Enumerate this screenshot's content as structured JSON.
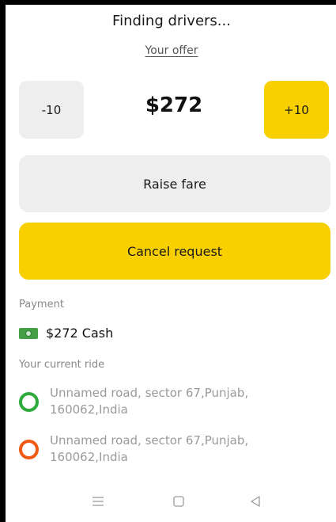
{
  "header": {
    "title": "Finding drivers..."
  },
  "offer": {
    "link_label": "Your offer",
    "decrement_label": "-10",
    "price": "$272",
    "increment_label": "+10"
  },
  "actions": {
    "raise_label": "Raise fare",
    "cancel_label": "Cancel request"
  },
  "payment": {
    "section_label": "Payment",
    "method_icon": "cash-icon",
    "method_text": "$272 Cash"
  },
  "ride": {
    "section_label": "Your current ride",
    "stops": [
      {
        "address": "Unnamed road, sector 67,Punjab, 160062,India",
        "marker_color": "#2eaa3d"
      },
      {
        "address": "Unnamed road, sector 67,Punjab, 160062,India",
        "marker_color": "#f05a12"
      }
    ]
  },
  "navbar": {
    "icons": [
      "menu-icon",
      "home-square-icon",
      "back-triangle-icon"
    ]
  },
  "colors": {
    "accent": "#f8d000",
    "neutral_button": "#eeeeee"
  }
}
